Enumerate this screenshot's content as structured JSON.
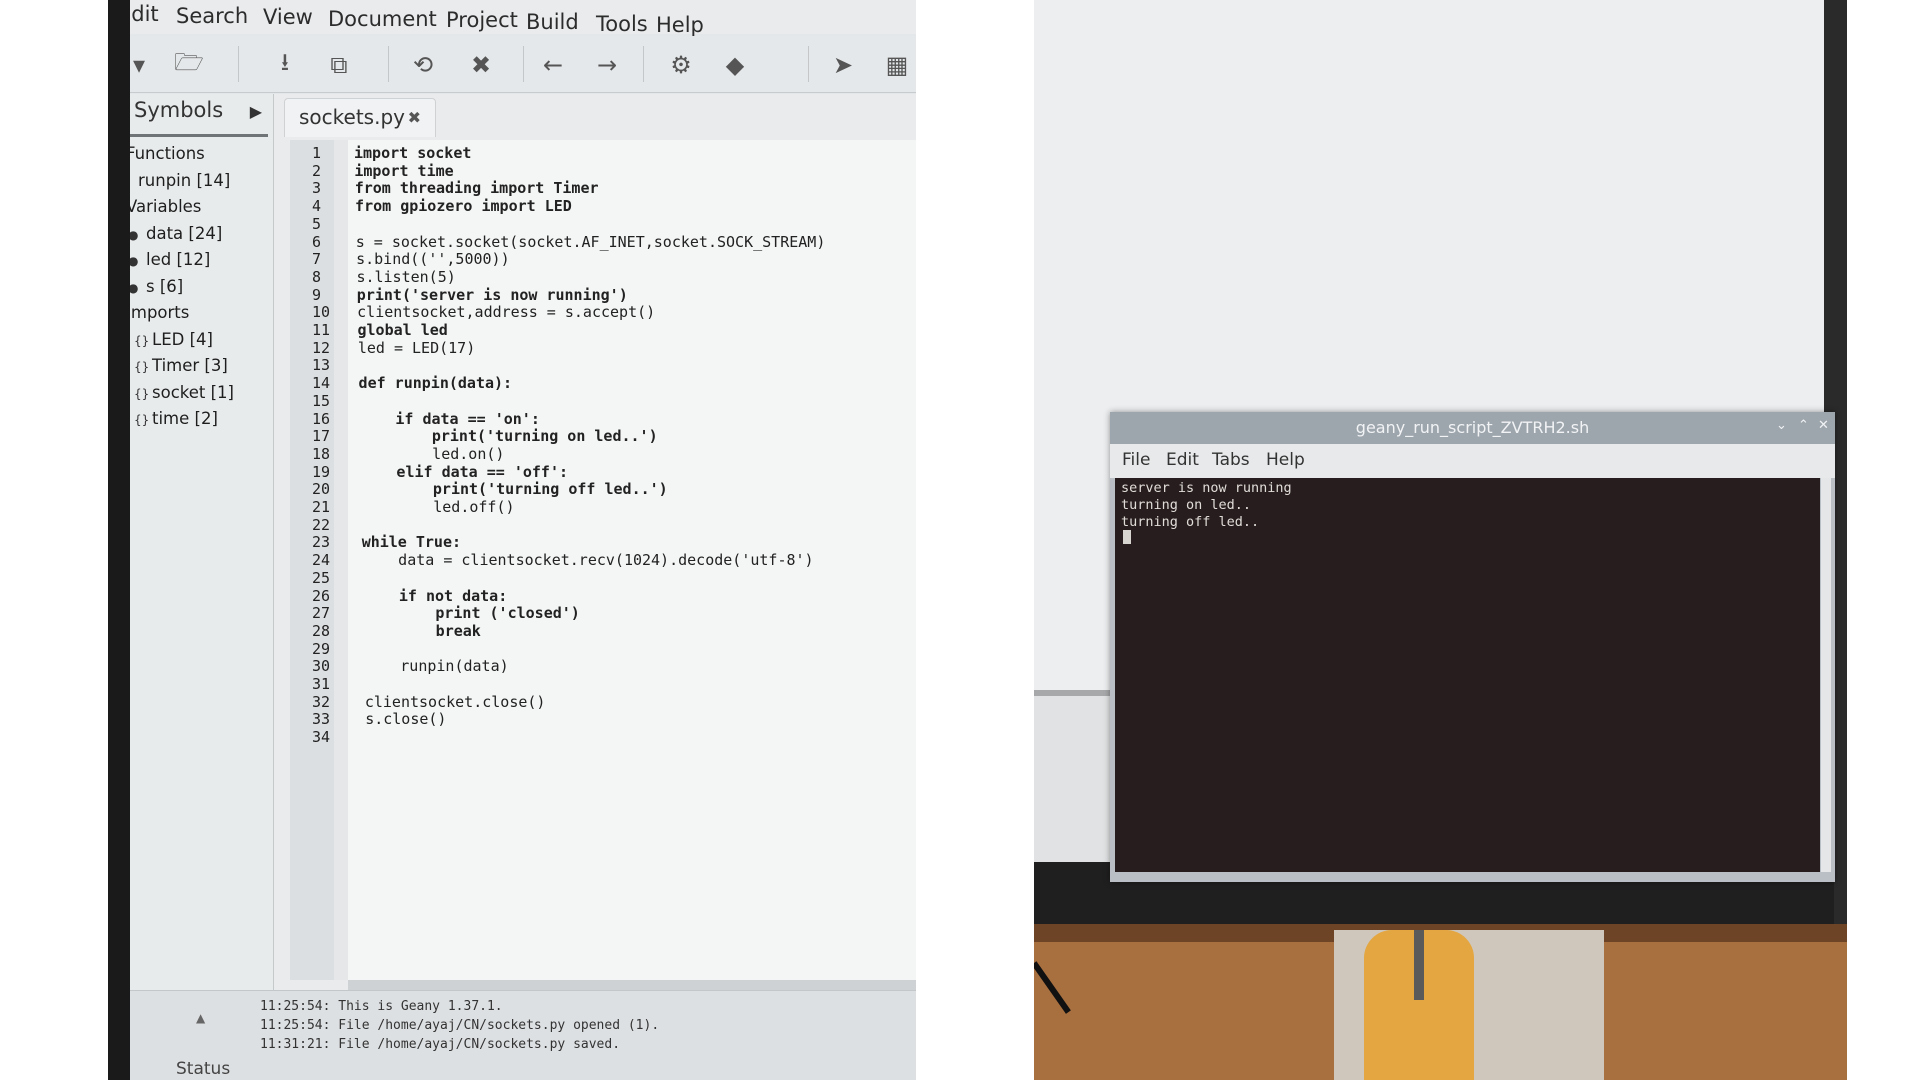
{
  "editor": {
    "menu": [
      "Edit",
      "Search",
      "View",
      "Document",
      "Project",
      "Build",
      "Tools",
      "Help"
    ],
    "toolbar_icons": [
      "new-file-icon",
      "open-folder-icon",
      "save-icon",
      "save-all-icon",
      "reload-icon",
      "close-file-icon",
      "back-icon",
      "forward-icon",
      "compile-icon",
      "build-icon",
      "send-icon",
      "color-icon"
    ],
    "sidebar_tab": "Symbols",
    "symbols": {
      "functions_label": "Functions",
      "functions": [
        "runpin [14]"
      ],
      "variables_label": "Variables",
      "variables": [
        "data [24]",
        "led [12]",
        "s [6]"
      ],
      "imports_label": "Imports",
      "imports": [
        "LED [4]",
        "Timer [3]",
        "socket [1]",
        "time [2]"
      ]
    },
    "file_tab": "sockets.py",
    "code_lines": [
      "import socket",
      "import time",
      "from threading import Timer",
      "from gpiozero import LED",
      "",
      "s = socket.socket(socket.AF_INET,socket.SOCK_STREAM)",
      "s.bind(('',5000))",
      "s.listen(5)",
      "print('server is now running')",
      "clientsocket,address = s.accept()",
      "global led",
      "led = LED(17)",
      "",
      "def runpin(data):",
      "",
      "    if data == 'on':",
      "        print('turning on led..')",
      "        led.on()",
      "    elif data == 'off':",
      "        print('turning off led..')",
      "        led.off()",
      "",
      "while True:",
      "    data = clientsocket.recv(1024).decode('utf-8')",
      "",
      "    if not data:",
      "        print ('closed')",
      "        break",
      "",
      "    runpin(data)",
      "",
      "clientsocket.close()",
      "s.close()",
      ""
    ],
    "status_label": "Status",
    "messages": [
      "11:25:54: This is Geany 1.37.1.",
      "11:25:54: File /home/ayaj/CN/sockets.py opened (1).",
      "11:31:21: File /home/ayaj/CN/sockets.py saved."
    ]
  },
  "terminal": {
    "title": "geany_run_script_ZVTRH2.sh",
    "menu": [
      "File",
      "Edit",
      "Tabs",
      "Help"
    ],
    "output": [
      "server is now running",
      "turning on led..",
      "turning off led.."
    ]
  }
}
